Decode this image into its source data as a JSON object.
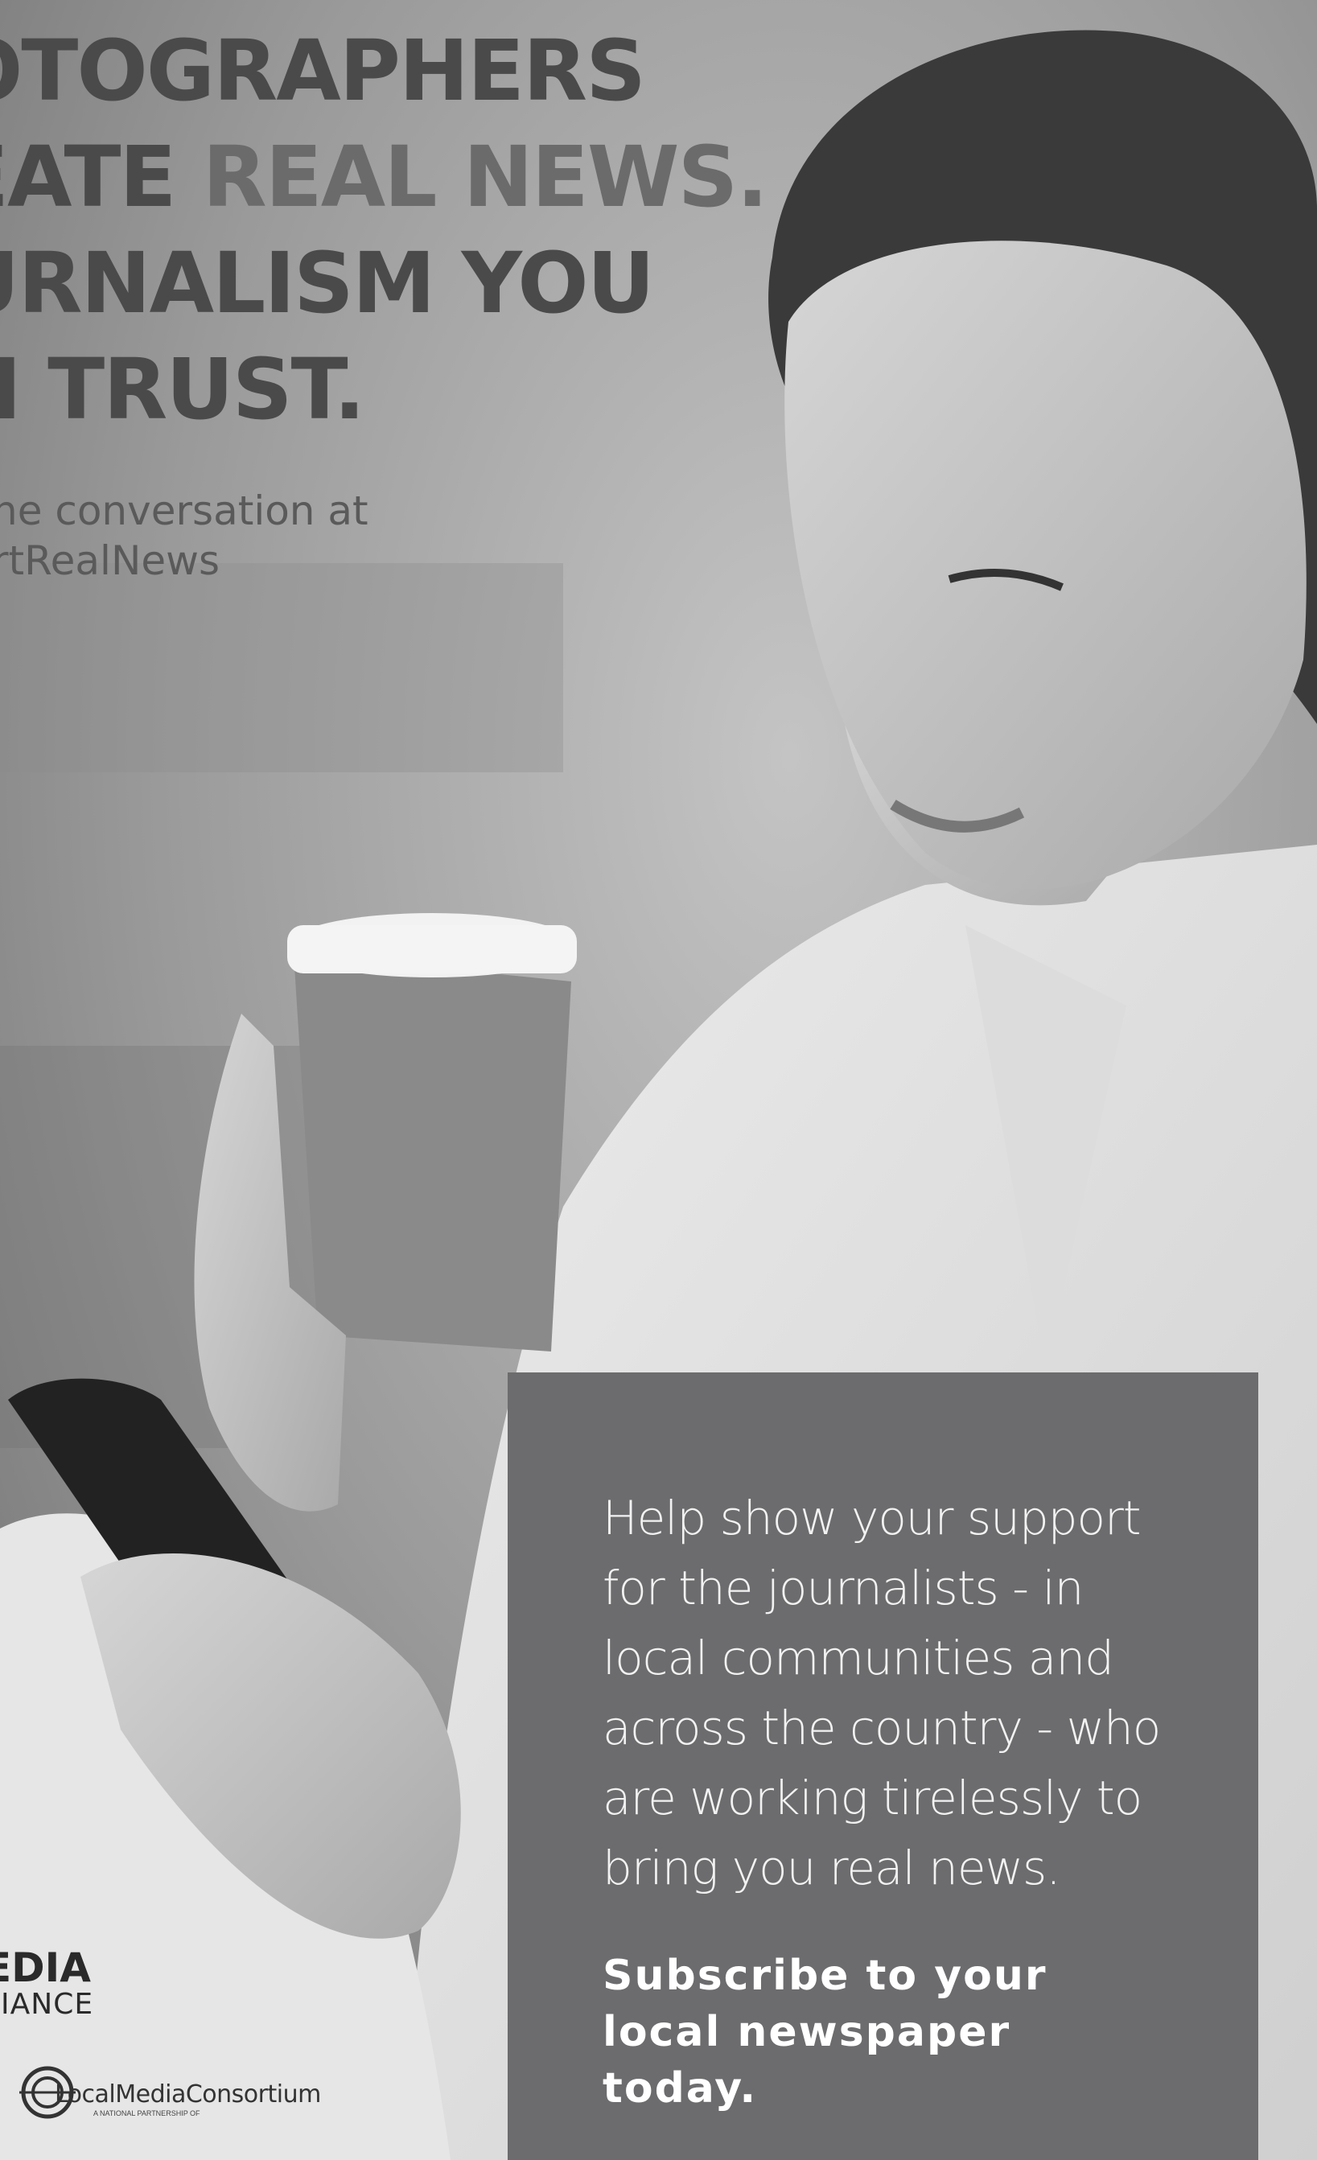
{
  "headline": {
    "line1": "OTOGRAPHERS",
    "line2_prefix": "EATE ",
    "line2_accent": "REAL NEWS.",
    "line3": "URNALISM YOU",
    "line4": "N TRUST."
  },
  "subline": {
    "line1": "he conversation at",
    "line2": "rtRealNews"
  },
  "info_box": {
    "body": "Help show your support for the journalists - in local communities and across the country - who are working tirelessly to bring you real news.",
    "cta_line1": "Subscribe to your",
    "cta_line2": "local newspaper",
    "cta_line3": "today."
  },
  "logos": {
    "media_big": "EDIA",
    "media_small": "LIANCE",
    "lmc_name": "LocalMediaConsortium",
    "lmc_tag": "A NATIONAL PARTNERSHIP OF"
  },
  "colors": {
    "box": "#6c6c6e",
    "headline": "#4a4a4a",
    "headline_accent": "#6b6b6b"
  }
}
